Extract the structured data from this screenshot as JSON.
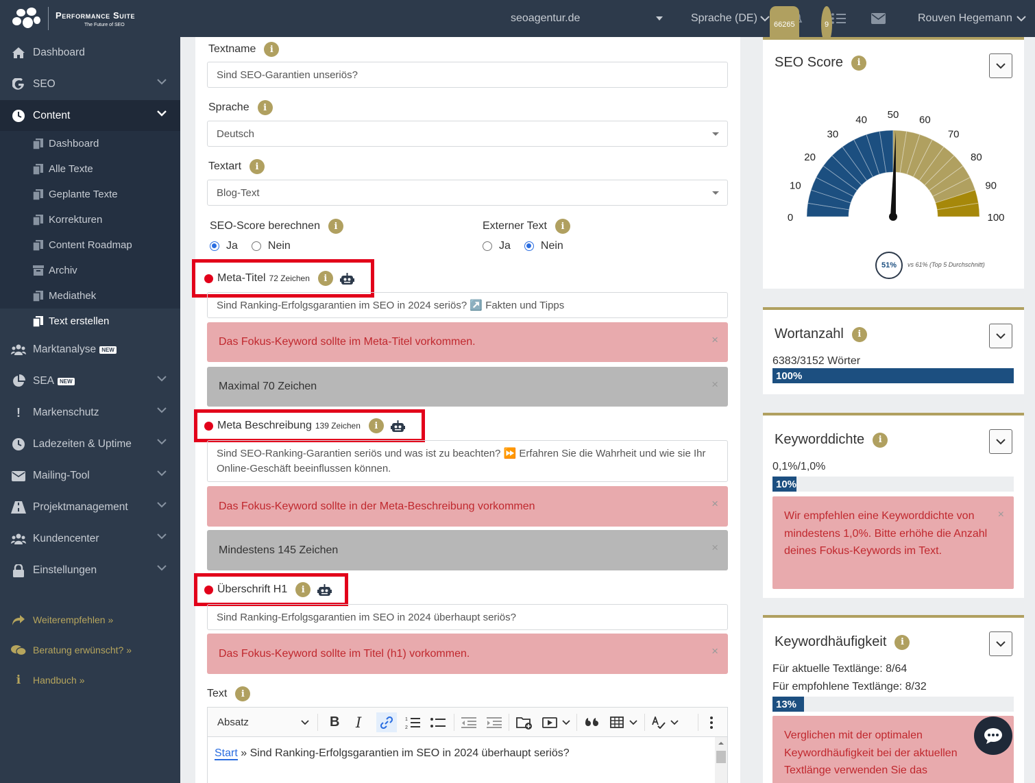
{
  "app": {
    "title": "Performance Suite",
    "tagline": "The Future of SEO"
  },
  "topbar": {
    "project": "seoagentur.de",
    "language": "Sprache (DE)",
    "notifications_count": "66265",
    "tasks_count": "9",
    "user": "Rouven Hegemann"
  },
  "sidebar": {
    "items": [
      {
        "label": "Dashboard",
        "icon": "home-icon"
      },
      {
        "label": "SEO",
        "icon": "google-icon"
      },
      {
        "label": "Content",
        "icon": "clock-icon"
      }
    ],
    "content_sub": [
      "Dashboard",
      "Alle Texte",
      "Geplante Texte",
      "Korrekturen",
      "Content Roadmap",
      "Archiv",
      "Mediathek",
      "Text erstellen"
    ],
    "items2": [
      {
        "label": "Marktanalyse",
        "icon": "users-icon"
      },
      {
        "label": "SEA",
        "icon": "pie-chart-icon"
      },
      {
        "label": "Markenschutz",
        "icon": "exclamation-icon"
      },
      {
        "label": "Ladezeiten & Uptime",
        "icon": "clock-icon"
      },
      {
        "label": "Mailing-Tool",
        "icon": "envelope-icon"
      },
      {
        "label": "Projektmanagement",
        "icon": "road-icon"
      },
      {
        "label": "Kundencenter",
        "icon": "users-icon"
      },
      {
        "label": "Einstellungen",
        "icon": "lock-icon"
      }
    ],
    "new_badge": "NEW",
    "extras": [
      "Weiterempfehlen »",
      "Beratung erwünscht? »",
      "Handbuch »"
    ]
  },
  "form": {
    "textname_label": "Textname",
    "textname_value": "Sind SEO-Garantien unseriös?",
    "sprache_label": "Sprache",
    "sprache_value": "Deutsch",
    "textart_label": "Textart",
    "textart_value": "Blog-Text",
    "seo_score_label": "SEO-Score berechnen",
    "extern_label": "Externer Text",
    "ja": "Ja",
    "nein": "Nein",
    "meta_title_label": "Meta-Titel",
    "meta_title_count": "72 Zeichen",
    "meta_title_value": "Sind Ranking-Erfolgsgarantien im SEO in 2024 seriös? ↗️ Fakten und Tipps",
    "meta_title_alert1": "Das Fokus-Keyword sollte im Meta-Titel vorkommen.",
    "meta_title_alert2": "Maximal 70 Zeichen",
    "meta_desc_label": "Meta Beschreibung",
    "meta_desc_count": "139 Zeichen",
    "meta_desc_value": "Sind SEO-Ranking-Garantien seriös und was ist zu beachten? ⏩ Erfahren Sie die Wahrheit und wie sie Ihr Online-Geschäft beeinflussen können.",
    "meta_desc_alert1": "Das Fokus-Keyword sollte in der Meta-Beschreibung vorkommen",
    "meta_desc_alert2": "Mindestens 145 Zeichen",
    "h1_label": "Überschrift H1",
    "h1_value": "Sind Ranking-Erfolgsgarantien im SEO in 2024 überhaupt seriös?",
    "h1_alert": "Das Fokus-Keyword sollte im Titel (h1) vorkommen.",
    "text_label": "Text",
    "editor_format": "Absatz",
    "editor_link": "Start",
    "editor_content": "» Sind Ranking-Erfolgsgarantien im SEO in 2024 überhaupt seriös?"
  },
  "seo_score": {
    "title": "SEO Score",
    "value": 51,
    "value_label": "51%",
    "compare": "vs 61% (Top 5 Durchschnitt)",
    "ticks": [
      "0",
      "10",
      "20",
      "30",
      "40",
      "50",
      "60",
      "70",
      "80",
      "90",
      "100"
    ],
    "colors": {
      "low": "#1c4f80",
      "high": "#b0a060",
      "max": "#a6880a"
    }
  },
  "wortanzahl": {
    "title": "Wortanzahl",
    "stat": "6383/3152 Wörter",
    "percent": 100,
    "percent_label": "100%"
  },
  "keyworddichte": {
    "title": "Keyworddichte",
    "stat": "0,1%/1,0%",
    "percent": 10,
    "percent_label": "10%",
    "alert": "Wir empfehlen eine Keyworddichte von mindestens 1,0%. Bitte erhöhe die Anzahl deines Fokus-Keywords im Text."
  },
  "keywordhaeufigkeit": {
    "title": "Keywordhäufigkeit",
    "stat1": "Für aktuelle Textlänge: 8/64",
    "stat2": "Für empfohlene Textlänge: 8/32",
    "percent": 13,
    "percent_label": "13%",
    "alert": "Verglichen mit der optimalen Keywordhäufigkeit bei der aktuellen Textlänge verwenden Sie das"
  },
  "close": "×",
  "info": "i"
}
